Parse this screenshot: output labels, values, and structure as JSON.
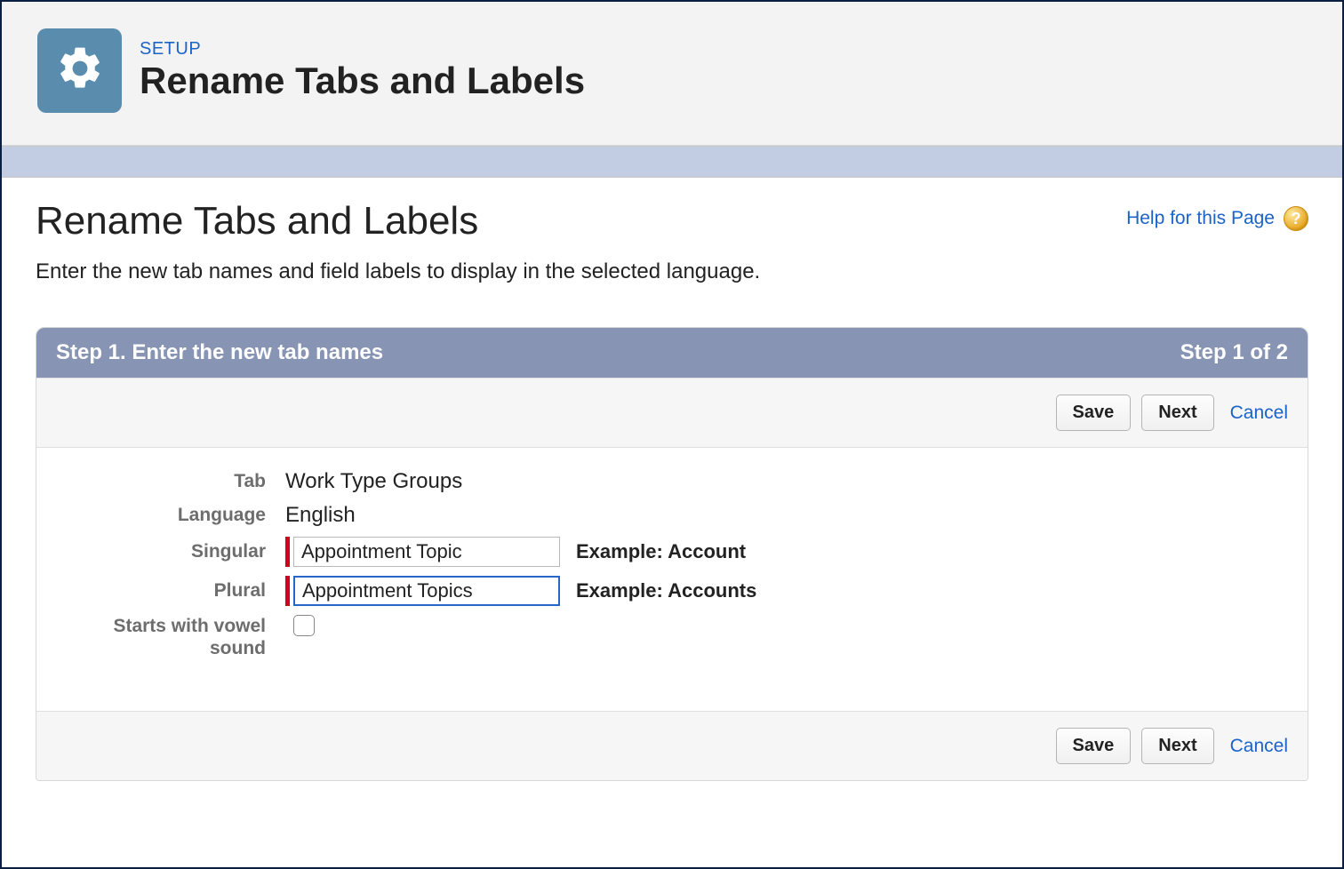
{
  "header": {
    "eyebrow": "SETUP",
    "title": "Rename Tabs and Labels"
  },
  "content": {
    "title": "Rename Tabs and Labels",
    "help_link": "Help for this Page",
    "description": "Enter the new tab names and field labels to display in the selected language."
  },
  "step": {
    "title": "Step 1. Enter the new tab names",
    "progress": "Step 1 of 2"
  },
  "actions": {
    "save": "Save",
    "next": "Next",
    "cancel": "Cancel"
  },
  "form": {
    "tab_label": "Tab",
    "tab_value": "Work Type Groups",
    "language_label": "Language",
    "language_value": "English",
    "singular_label": "Singular",
    "singular_value": "Appointment Topic",
    "singular_example": "Example: Account",
    "plural_label": "Plural",
    "plural_value": "Appointment Topics",
    "plural_example": "Example: Accounts",
    "vowel_label": "Starts with vowel sound"
  }
}
